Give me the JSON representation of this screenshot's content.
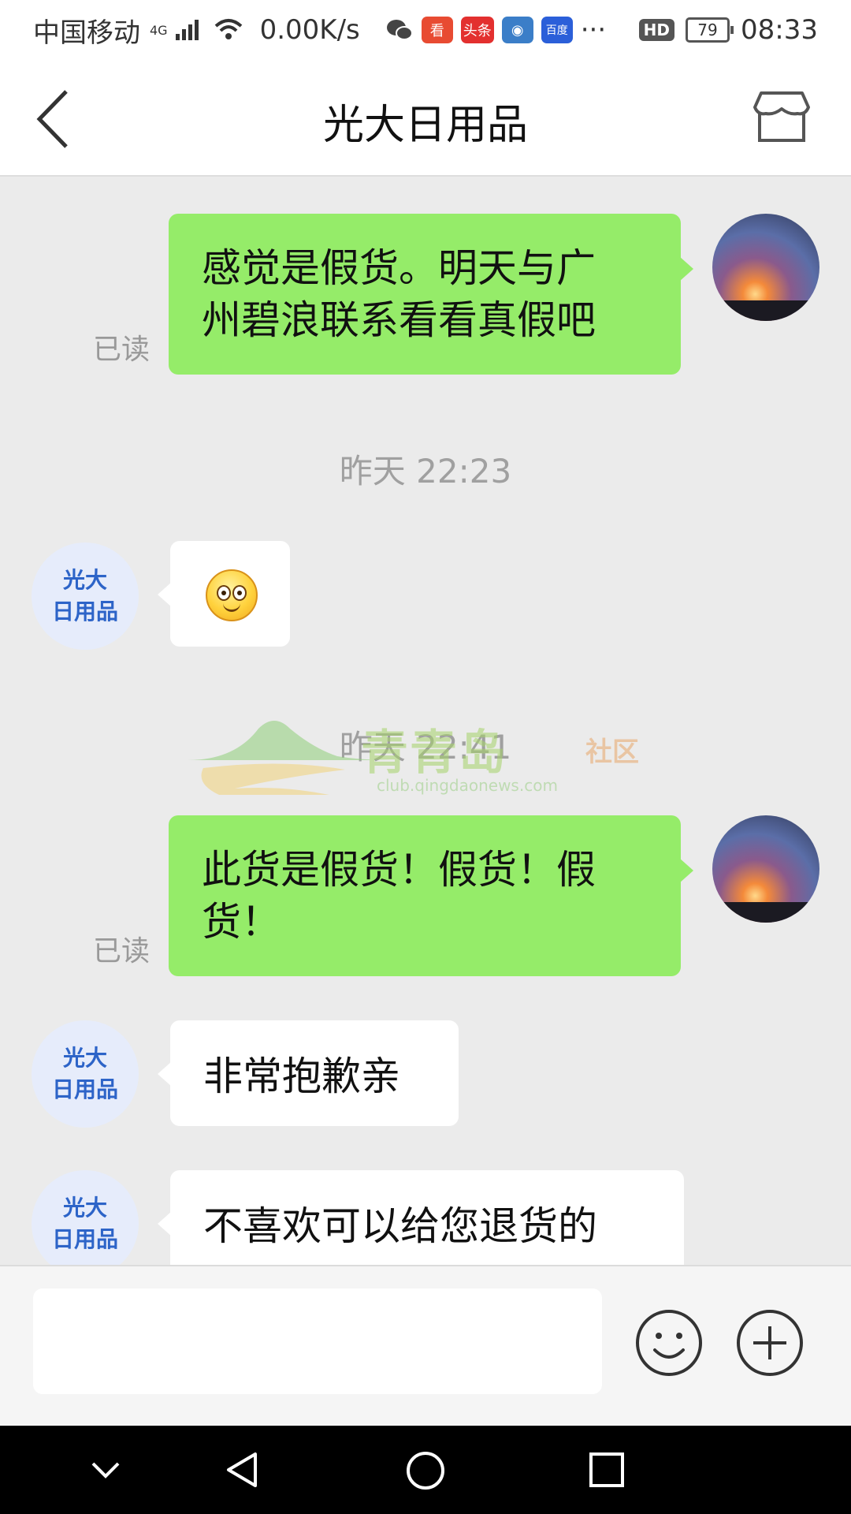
{
  "status_bar": {
    "carrier": "中国移动",
    "network_type": "4G",
    "speed": "0.00K/s",
    "app_icons": [
      "wechat-icon",
      "kan-app-icon",
      "toutiao-icon",
      "eye-app-icon",
      "baidu-icon"
    ],
    "app_labels": {
      "kan": "看",
      "toutiao": "头条",
      "baidu": "百度"
    },
    "more": "···",
    "hd": "HD",
    "battery": "79",
    "time": "08:33"
  },
  "header": {
    "title": "光大日用品",
    "back_icon": "chevron-left-icon",
    "store_icon": "store-icon"
  },
  "shop_avatar": {
    "line1": "光大",
    "line2": "日用品"
  },
  "messages": [
    {
      "side": "me",
      "line1": "感觉是假货。明天与广",
      "line2": "州碧浪联系看看真假吧",
      "status": "已读"
    },
    {
      "type": "time",
      "text": "昨天 22:23"
    },
    {
      "side": "shop",
      "content": "emoji",
      "emoji_icon": "flushed-smile-emoji"
    },
    {
      "type": "time",
      "text": "昨天 22:41"
    },
    {
      "side": "me",
      "line1": "此货是假货！假货！假",
      "line2": "货！",
      "status": "已读"
    },
    {
      "side": "shop",
      "text": "非常抱歉亲"
    },
    {
      "side": "shop",
      "text": "不喜欢可以给您退货的"
    }
  ],
  "watermark": {
    "title": "青青岛",
    "sub": "社区",
    "url": "club.qingdaonews.com"
  },
  "input_bar": {
    "placeholder": "",
    "emoji_icon": "smiley-icon",
    "plus_icon": "plus-circle-icon"
  },
  "system_nav": {
    "icons": [
      "chevron-down-icon",
      "back-triangle-icon",
      "home-circle-icon",
      "recents-square-icon"
    ]
  },
  "colors": {
    "my_bubble": "#95ec69",
    "shop_bubble": "#ffffff",
    "chat_background": "#ebebeb",
    "shop_avatar_text": "#2d64c8"
  }
}
